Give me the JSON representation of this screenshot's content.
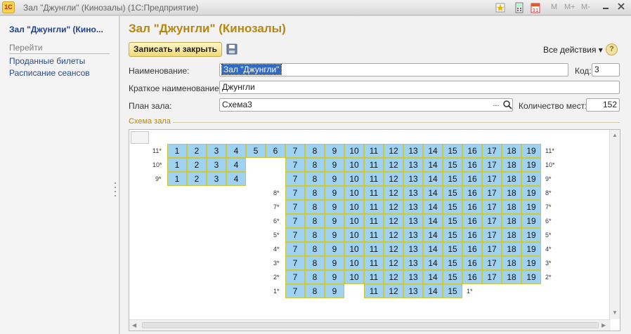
{
  "window": {
    "title": "Зал \"Джунгли\" (Кинозалы)  (1С:Предприятие)",
    "logo": "1С",
    "toolbar_right": [
      "M",
      "M+",
      "M-"
    ]
  },
  "left_panel": {
    "title": "Зал \"Джунгли\" (Кино...",
    "section": "Перейти",
    "links": [
      "Проданные билеты",
      "Расписание сеансов"
    ]
  },
  "form": {
    "title": "Зал \"Джунгли\" (Кинозалы)",
    "save_close_label": "Записать и закрыть",
    "all_actions_label": "Все действия ▾",
    "help_label": "?",
    "name_label": "Наименование:",
    "name_value": "Зал \"Джунгли\"",
    "code_label": "Код:",
    "code_value": "3",
    "short_name_label": "Краткое наименование:",
    "short_name_value": "Джунгли",
    "plan_label": "План зала:",
    "plan_value": "Схема3",
    "plan_select_btn": "...",
    "seats_label": "Количество мест:",
    "seats_value": "152",
    "scheme_section": "Схема зала"
  },
  "hall": {
    "seat_color": "#9fd2f1",
    "border_color": "#ccc83a",
    "rows": [
      {
        "row": 11,
        "label": "11*",
        "seats": [
          1,
          2,
          3,
          4,
          5,
          6,
          7,
          8,
          9,
          10,
          11,
          12,
          13,
          14,
          15,
          16,
          17,
          18,
          19
        ]
      },
      {
        "row": 10,
        "label": "10*",
        "seats": [
          1,
          2,
          3,
          4,
          7,
          8,
          9,
          10,
          11,
          12,
          13,
          14,
          15,
          16,
          17,
          18,
          19
        ]
      },
      {
        "row": 9,
        "label": "9*",
        "seats": [
          1,
          2,
          3,
          4,
          7,
          8,
          9,
          10,
          11,
          12,
          13,
          14,
          15,
          16,
          17,
          18,
          19
        ]
      },
      {
        "row": 8,
        "label": "8*",
        "seats": [
          7,
          8,
          9,
          10,
          11,
          12,
          13,
          14,
          15,
          16,
          17,
          18,
          19
        ]
      },
      {
        "row": 7,
        "label": "7*",
        "seats": [
          7,
          8,
          9,
          10,
          11,
          12,
          13,
          14,
          15,
          16,
          17,
          18,
          19
        ]
      },
      {
        "row": 6,
        "label": "6*",
        "seats": [
          7,
          8,
          9,
          10,
          11,
          12,
          13,
          14,
          15,
          16,
          17,
          18,
          19
        ]
      },
      {
        "row": 5,
        "label": "5*",
        "seats": [
          7,
          8,
          9,
          10,
          11,
          12,
          13,
          14,
          15,
          16,
          17,
          18,
          19
        ]
      },
      {
        "row": 4,
        "label": "4*",
        "seats": [
          7,
          8,
          9,
          10,
          11,
          12,
          13,
          14,
          15,
          16,
          17,
          18,
          19
        ]
      },
      {
        "row": 3,
        "label": "3*",
        "seats": [
          7,
          8,
          9,
          10,
          11,
          12,
          13,
          14,
          15,
          16,
          17,
          18,
          19
        ]
      },
      {
        "row": 2,
        "label": "2*",
        "seats": [
          7,
          8,
          9,
          10,
          11,
          12,
          13,
          14,
          15,
          16,
          17,
          18,
          19
        ]
      },
      {
        "row": 1,
        "label": "1*",
        "seats": [
          7,
          8,
          9,
          11,
          12,
          13,
          14,
          15
        ]
      }
    ]
  }
}
